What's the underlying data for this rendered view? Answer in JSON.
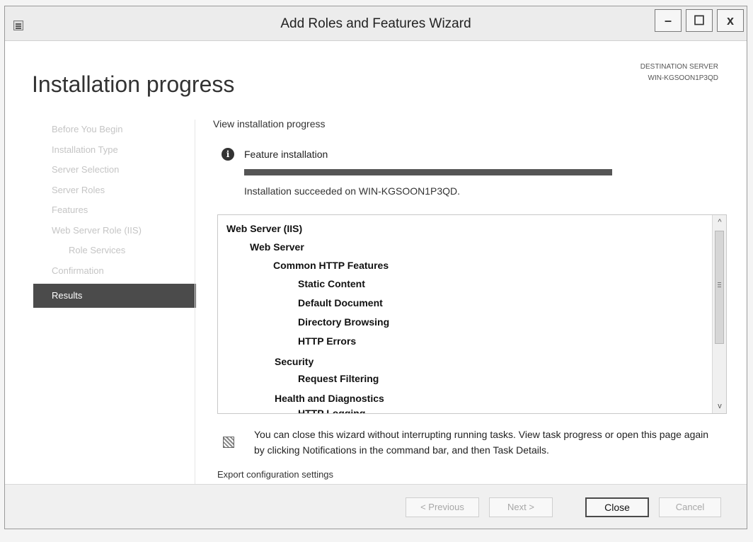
{
  "window": {
    "title": "Add Roles and Features Wizard",
    "controls": {
      "minimize": "–",
      "maximize": "☐",
      "close": "x"
    }
  },
  "header": {
    "heading": "Installation progress",
    "destination_label": "DESTINATION SERVER",
    "destination_server": "WIN-KGSOON1P3QD"
  },
  "steps": [
    {
      "label": "Before You Begin",
      "state": "done"
    },
    {
      "label": "Installation Type",
      "state": "done"
    },
    {
      "label": "Server Selection",
      "state": "done"
    },
    {
      "label": "Server Roles",
      "state": "done"
    },
    {
      "label": "Features",
      "state": "done"
    },
    {
      "label": "Web Server Role (IIS)",
      "state": "done"
    },
    {
      "label": "Role Services",
      "state": "done"
    },
    {
      "label": "Confirmation",
      "state": "done"
    },
    {
      "label": "Results",
      "state": "active"
    }
  ],
  "main": {
    "section_title": "View installation progress",
    "feature_label": "Feature installation",
    "progress_percent": 100,
    "status": "Installation succeeded on WIN-KGSOON1P3QD.",
    "items": [
      {
        "label": "Web Server (IIS)",
        "level": 0
      },
      {
        "label": "Web Server",
        "level": 1
      },
      {
        "label": "Common HTTP Features",
        "level": 2
      },
      {
        "label": "Static Content",
        "level": 3
      },
      {
        "label": "Default Document",
        "level": 3
      },
      {
        "label": "Directory Browsing",
        "level": 3
      },
      {
        "label": "HTTP Errors",
        "level": 3
      },
      {
        "label": "Security",
        "level": 2
      },
      {
        "label": "Request Filtering",
        "level": 3
      },
      {
        "label": "Health and Diagnostics",
        "level": 2
      },
      {
        "label": "HTTP Logging",
        "level": 3
      }
    ],
    "notice": "You can close this wizard without interrupting running tasks. View task progress or open this page again by clicking Notifications in the command bar, and then Task Details.",
    "export_link": "Export configuration settings"
  },
  "footer": {
    "previous": "< Previous",
    "next": "Next >",
    "close": "Close",
    "cancel": "Cancel"
  }
}
